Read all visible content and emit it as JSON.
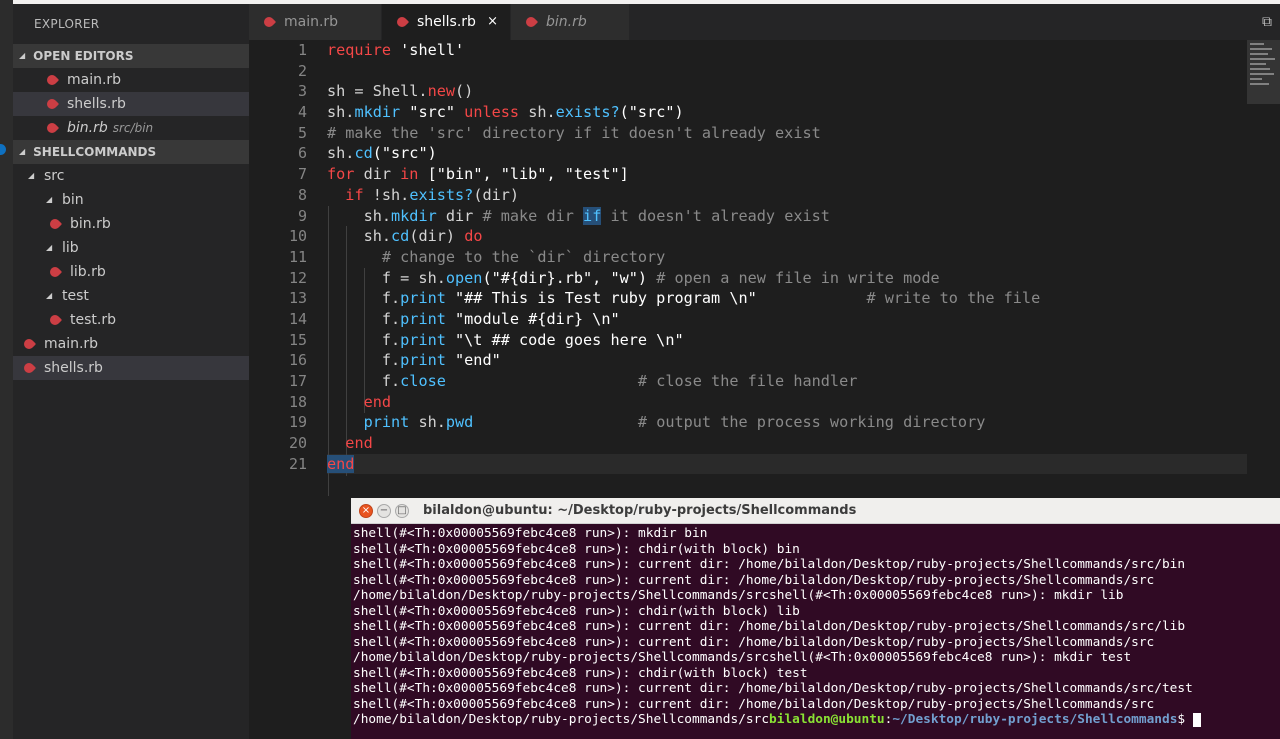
{
  "sidebar": {
    "title": "EXPLORER",
    "open_editors_label": "OPEN EDITORS",
    "open_editors": [
      {
        "name": "main.rb",
        "sub": ""
      },
      {
        "name": "shells.rb",
        "sub": ""
      },
      {
        "name": "bin.rb",
        "sub": "src/bin"
      }
    ],
    "project_label": "SHELLCOMMANDS",
    "tree": [
      {
        "name": "src"
      },
      {
        "name": "bin"
      },
      {
        "name": "bin.rb"
      },
      {
        "name": "lib"
      },
      {
        "name": "lib.rb"
      },
      {
        "name": "test"
      },
      {
        "name": "test.rb"
      },
      {
        "name": "main.rb"
      },
      {
        "name": "shells.rb"
      }
    ]
  },
  "tabs": [
    {
      "label": "main.rb"
    },
    {
      "label": "shells.rb",
      "close": "×"
    },
    {
      "label": "bin.rb"
    }
  ],
  "colors": {
    "keyword": "#f44747",
    "string": "#ffffff",
    "comment": "#8a8a8a",
    "method": "#4fc1ff",
    "ruby_icon": "#cc3e44",
    "terminal_bg": "#300a24"
  },
  "editor": {
    "line_numbers": [
      "1",
      "2",
      "3",
      "4",
      "5",
      "6",
      "7",
      "8",
      "9",
      "10",
      "11",
      "12",
      "13",
      "14",
      "15",
      "16",
      "17",
      "18",
      "19",
      "20",
      "21"
    ],
    "lines": [
      [
        {
          "t": "require ",
          "c": "kw"
        },
        {
          "t": "'shell'",
          "c": "str"
        }
      ],
      [],
      [
        {
          "t": "sh = Shell.",
          "c": "id"
        },
        {
          "t": "new",
          "c": "kw"
        },
        {
          "t": "()",
          "c": "id"
        }
      ],
      [
        {
          "t": "sh.",
          "c": "id"
        },
        {
          "t": "mkdir",
          "c": "fn"
        },
        {
          "t": " \"src\" ",
          "c": "str"
        },
        {
          "t": "unless",
          "c": "kw"
        },
        {
          "t": " sh.",
          "c": "id"
        },
        {
          "t": "exists?",
          "c": "fn"
        },
        {
          "t": "(\"src\")",
          "c": "str"
        }
      ],
      [
        {
          "t": "# make the 'src' directory if it doesn't already exist",
          "c": "cm"
        }
      ],
      [
        {
          "t": "sh.",
          "c": "id"
        },
        {
          "t": "cd",
          "c": "fn"
        },
        {
          "t": "(\"src\")",
          "c": "str"
        }
      ],
      [
        {
          "t": "for",
          "c": "kw"
        },
        {
          "t": " dir ",
          "c": "id"
        },
        {
          "t": "in",
          "c": "kw"
        },
        {
          "t": " [\"bin\", \"lib\", \"test\"]",
          "c": "str"
        }
      ],
      [
        {
          "t": "  ",
          "c": "id"
        },
        {
          "t": "if",
          "c": "kw"
        },
        {
          "t": " !sh.",
          "c": "id"
        },
        {
          "t": "exists?",
          "c": "fn"
        },
        {
          "t": "(dir)",
          "c": "id"
        }
      ],
      [
        {
          "t": "    sh.",
          "c": "id"
        },
        {
          "t": "mkdir",
          "c": "fn"
        },
        {
          "t": " dir ",
          "c": "id"
        },
        {
          "t": "# make dir ",
          "c": "cm"
        },
        {
          "t": "if",
          "c": "hl"
        },
        {
          "t": " it doesn't already exist",
          "c": "cm"
        }
      ],
      [
        {
          "t": "    sh.",
          "c": "id"
        },
        {
          "t": "cd",
          "c": "fn"
        },
        {
          "t": "(dir) ",
          "c": "id"
        },
        {
          "t": "do",
          "c": "kw"
        }
      ],
      [
        {
          "t": "      ",
          "c": "id"
        },
        {
          "t": "# change to the `dir` directory",
          "c": "cm"
        }
      ],
      [
        {
          "t": "      f = sh.",
          "c": "id"
        },
        {
          "t": "open",
          "c": "fn"
        },
        {
          "t": "(\"#{dir}.rb\", \"w\") ",
          "c": "str"
        },
        {
          "t": "# open a new file in write mode",
          "c": "cm"
        }
      ],
      [
        {
          "t": "      f.",
          "c": "id"
        },
        {
          "t": "print",
          "c": "fn"
        },
        {
          "t": " \"## This is Test ruby program \\n\"            ",
          "c": "str"
        },
        {
          "t": "# write to the file",
          "c": "cm"
        }
      ],
      [
        {
          "t": "      f.",
          "c": "id"
        },
        {
          "t": "print",
          "c": "fn"
        },
        {
          "t": " \"module #{dir} \\n\"",
          "c": "str"
        }
      ],
      [
        {
          "t": "      f.",
          "c": "id"
        },
        {
          "t": "print",
          "c": "fn"
        },
        {
          "t": " \"\\t ## code goes here \\n\"",
          "c": "str"
        }
      ],
      [
        {
          "t": "      f.",
          "c": "id"
        },
        {
          "t": "print",
          "c": "fn"
        },
        {
          "t": " \"end\"",
          "c": "str"
        }
      ],
      [
        {
          "t": "      f.",
          "c": "id"
        },
        {
          "t": "close",
          "c": "fn"
        },
        {
          "t": "                     ",
          "c": "id"
        },
        {
          "t": "# close the file handler",
          "c": "cm"
        }
      ],
      [
        {
          "t": "    ",
          "c": "id"
        },
        {
          "t": "end",
          "c": "kw"
        }
      ],
      [
        {
          "t": "    ",
          "c": "id"
        },
        {
          "t": "print",
          "c": "fn"
        },
        {
          "t": " sh.",
          "c": "id"
        },
        {
          "t": "pwd",
          "c": "fn"
        },
        {
          "t": "                  ",
          "c": "id"
        },
        {
          "t": "# output the process working directory",
          "c": "cm"
        }
      ],
      [
        {
          "t": "  ",
          "c": "id"
        },
        {
          "t": "end",
          "c": "kw"
        }
      ],
      [
        {
          "t": "end",
          "c": "kwsel"
        }
      ]
    ]
  },
  "terminal": {
    "title": "bilaldon@ubuntu: ~/Desktop/ruby-projects/Shellcommands",
    "lines": [
      "shell(#<Th:0x00005569febc4ce8 run>): mkdir bin",
      "shell(#<Th:0x00005569febc4ce8 run>): chdir(with block) bin",
      "shell(#<Th:0x00005569febc4ce8 run>): current dir: /home/bilaldon/Desktop/ruby-projects/Shellcommands/src/bin",
      "shell(#<Th:0x00005569febc4ce8 run>): current dir: /home/bilaldon/Desktop/ruby-projects/Shellcommands/src",
      "/home/bilaldon/Desktop/ruby-projects/Shellcommands/srcshell(#<Th:0x00005569febc4ce8 run>): mkdir lib",
      "shell(#<Th:0x00005569febc4ce8 run>): chdir(with block) lib",
      "shell(#<Th:0x00005569febc4ce8 run>): current dir: /home/bilaldon/Desktop/ruby-projects/Shellcommands/src/lib",
      "shell(#<Th:0x00005569febc4ce8 run>): current dir: /home/bilaldon/Desktop/ruby-projects/Shellcommands/src",
      "/home/bilaldon/Desktop/ruby-projects/Shellcommands/srcshell(#<Th:0x00005569febc4ce8 run>): mkdir test",
      "shell(#<Th:0x00005569febc4ce8 run>): chdir(with block) test",
      "shell(#<Th:0x00005569febc4ce8 run>): current dir: /home/bilaldon/Desktop/ruby-projects/Shellcommands/src/test",
      "shell(#<Th:0x00005569febc4ce8 run>): current dir: /home/bilaldon/Desktop/ruby-projects/Shellcommands/src"
    ],
    "prompt_prefix": "/home/bilaldon/Desktop/ruby-projects/Shellcommands/src",
    "prompt_user": "bilaldon@ubuntu",
    "prompt_colon": ":",
    "prompt_path": "~/Desktop/ruby-projects/Shellcommands",
    "prompt_symbol": "$ "
  }
}
